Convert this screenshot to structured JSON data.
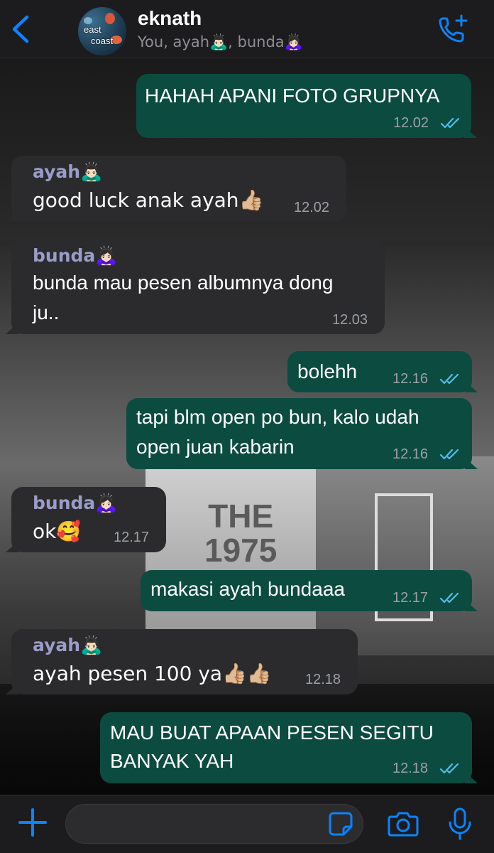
{
  "header": {
    "title": "eknath",
    "subtitle": "You, ayah🙇🏻‍♂️, bunda🙇🏻‍♀️",
    "avatar_text_1": "east",
    "avatar_text_2": "coast",
    "accent_color": "#0a84ff"
  },
  "stage": {
    "screen_line_1": "THE",
    "screen_line_2": "1975"
  },
  "messages": [
    {
      "id": "m1",
      "direction": "out",
      "text": "HAHAH APANI FOTO GRUPNYA",
      "time": "12.02",
      "read": true
    },
    {
      "id": "m2",
      "direction": "in",
      "sender": "ayah🙇🏻‍♂️",
      "text": "good luck anak ayah👍🏼",
      "time": "12.02"
    },
    {
      "id": "m3",
      "direction": "in",
      "sender": "bunda🙇🏻‍♀️",
      "text_line_1": "bunda mau pesen albumnya dong",
      "text_line_2": "ju..",
      "time": "12.03"
    },
    {
      "id": "m4",
      "direction": "out",
      "text": "bolehh",
      "time": "12.16",
      "read": true
    },
    {
      "id": "m5",
      "direction": "out",
      "text_line_1": "tapi blm open po bun, kalo udah",
      "text_line_2": "open juan kabarin",
      "time": "12.16",
      "read": true
    },
    {
      "id": "m6",
      "direction": "in",
      "sender": "bunda🙇🏻‍♀️",
      "text": "ok🥰",
      "time": "12.17"
    },
    {
      "id": "m7",
      "direction": "out",
      "text": "makasi ayah bundaaa",
      "time": "12.17",
      "read": true
    },
    {
      "id": "m8",
      "direction": "in",
      "sender": "ayah🙇🏻‍♂️",
      "text": "ayah pesen 100 ya👍🏼👍🏼",
      "time": "12.18"
    },
    {
      "id": "m9",
      "direction": "out",
      "text_line_1": "MAU BUAT APAAN PESEN SEGITU",
      "text_line_2": "BANYAK YAH",
      "time": "12.18",
      "read": true
    }
  ],
  "composer": {
    "value": "",
    "placeholder": ""
  },
  "colors": {
    "outgoing_bubble": "#0c4c40",
    "incoming_bubble": "#2b2b2d",
    "sender_name": "#9a9dc9",
    "read_ticks": "#53bdeb",
    "timestamp": "#9ba0a3"
  },
  "icons": [
    "back-chevron-icon",
    "add-call-icon",
    "plus-icon",
    "sticker-icon",
    "camera-icon",
    "microphone-icon",
    "read-ticks-icon"
  ]
}
